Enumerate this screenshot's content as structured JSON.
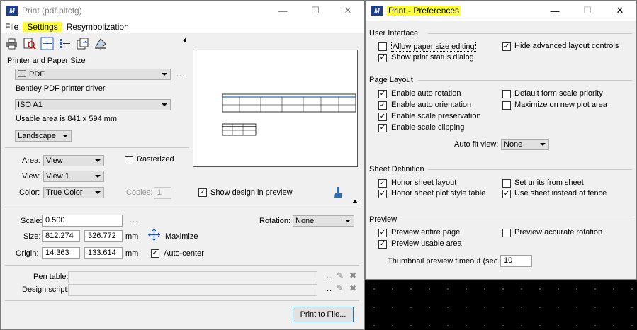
{
  "print_window": {
    "title": "Print  (pdf.pltcfg)",
    "menu": [
      "File",
      "Settings",
      "Resymbolization"
    ],
    "printer_section_label": "Printer and Paper Size",
    "printer": "PDF",
    "driver": "Bentley PDF printer driver",
    "paper": "ISO A1",
    "usable_area": "Usable area is 841 x 594 mm",
    "orientation": "Landscape",
    "area_label": "Area:",
    "area_value": "View",
    "rasterized_label": "Rasterized",
    "view_label": "View:",
    "view_value": "View 1",
    "color_label": "Color:",
    "color_value": "True Color",
    "copies_label": "Copies:",
    "copies_value": "1",
    "show_design_label": "Show design in preview",
    "scale_label": "Scale:",
    "scale_value": "0.500",
    "rotation_label": "Rotation:",
    "rotation_value": "None",
    "size_label": "Size:",
    "size_x": "812.274",
    "size_y": "326.772",
    "size_unit": "mm",
    "maximize_label": "Maximize",
    "origin_label": "Origin:",
    "origin_x": "14.363",
    "origin_y": "133.614",
    "origin_unit": "mm",
    "autocenter_label": "Auto-center",
    "pen_table_label": "Pen table:",
    "design_script_label": "Design script:",
    "print_button": "Print to File...",
    "ellipsis": "..."
  },
  "prefs_window": {
    "title": "Print - Preferences",
    "user_interface": "User Interface",
    "allow_paper": "Allow paper size editing",
    "show_status": "Show print status dialog",
    "hide_advanced": "Hide advanced layout controls",
    "page_layout": "Page Layout",
    "auto_rotation": "Enable auto rotation",
    "auto_orientation": "Enable auto orientation",
    "scale_preservation": "Enable scale preservation",
    "scale_clipping": "Enable scale clipping",
    "default_form": "Default form scale priority",
    "maximize_new": "Maximize on new plot area",
    "auto_fit_label": "Auto fit view:",
    "auto_fit_value": "None",
    "sheet_definition": "Sheet Definition",
    "honor_sheet": "Honor sheet layout",
    "honor_plot_style": "Honor sheet plot style table",
    "set_units": "Set units from sheet",
    "use_sheet": "Use sheet instead of fence",
    "preview": "Preview",
    "preview_entire": "Preview entire page",
    "preview_usable": "Preview usable area",
    "preview_accurate": "Preview accurate rotation",
    "thumb_label": "Thumbnail preview timeout (sec.):",
    "thumb_value": "10"
  },
  "colors": {
    "highlight": "#ffff33",
    "focus_border": "#0078d7",
    "app_icon": "#1e3f8f"
  }
}
